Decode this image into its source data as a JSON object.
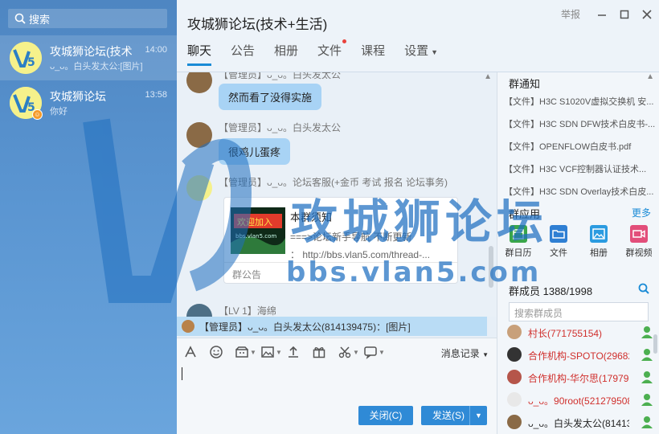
{
  "sidebar": {
    "search_placeholder": "搜索",
    "conversations": [
      {
        "title": "攻城狮论坛(技术",
        "time": "14:00",
        "preview": "ᴗ_ᴗ。白头发太公:[图片]"
      },
      {
        "title": "攻城狮论坛",
        "time": "13:58",
        "preview": "你好"
      }
    ]
  },
  "header": {
    "title": "攻城狮论坛(技术+生活)",
    "report": "举报",
    "tabs": [
      {
        "label": "聊天"
      },
      {
        "label": "公告"
      },
      {
        "label": "相册"
      },
      {
        "label": "文件"
      },
      {
        "label": "课程"
      },
      {
        "label": "设置"
      }
    ]
  },
  "chat": {
    "messages": [
      {
        "sender": "【管理员】ᴗ_ᴗ。白头发太公",
        "text": "然而看了没得实施"
      },
      {
        "sender": "【管理员】ᴗ_ᴗ。白头发太公",
        "text": "很鸡儿蛋疼"
      },
      {
        "sender": "【管理员】ᴗ_ᴗ。论坛客服(+金币 考试 报名 论坛事务)"
      },
      {
        "sender": "【LV 1】海绵"
      }
    ],
    "notice_card": {
      "title": "本群须知",
      "desc_line1": "===>论坛新手导航 不断更新",
      "desc_line2": "：  http://bbs.vlan5.com/thread-...",
      "footer": "群公告",
      "thumb_text": "欢迎加入",
      "thumb_url": "bbs.vlan5.com"
    },
    "mention": "【管理员】ᴗ_ᴗ。白头发太公(814139475)：[图片]"
  },
  "input": {
    "history_label": "消息记录",
    "close_label": "关闭(C)",
    "send_label": "发送(S)"
  },
  "right_panel": {
    "notice_heading": "群通知",
    "files": [
      "【文件】H3C S1020V虚拟交换机 安...",
      "【文件】H3C SDN DFW技术白皮书-...",
      "【文件】OPENFLOW白皮书.pdf",
      "【文件】H3C VCF控制器认证技术...",
      "【文件】H3C SDN Overlay技术白皮..."
    ],
    "apps_heading": "群应用",
    "apps_more": "更多",
    "apps": [
      {
        "label": "群日历",
        "color": "#3aa64a"
      },
      {
        "label": "文件",
        "color": "#2f7fd3"
      },
      {
        "label": "相册",
        "color": "#2b9be0"
      },
      {
        "label": "群视频",
        "color": "#e24e7a"
      }
    ],
    "members_heading": "群成员 1388/1998",
    "member_search_placeholder": "搜索群成员",
    "members": [
      {
        "name": "村长(771755154)",
        "color": "#d0302d"
      },
      {
        "name": "合作机构-SPOTO(296826",
        "color": "#d0302d"
      },
      {
        "name": "合作机构-华尔思(17979",
        "color": "#d0302d"
      },
      {
        "name": "ᴗ_ᴗ。90root(521279508)",
        "color": "#d0302d"
      },
      {
        "name": "ᴗ_ᴗ。白头发太公(81413",
        "color": "#222222"
      }
    ]
  },
  "watermark": {
    "cn": "攻城狮论坛",
    "url": "bbs.vlan5.com"
  }
}
